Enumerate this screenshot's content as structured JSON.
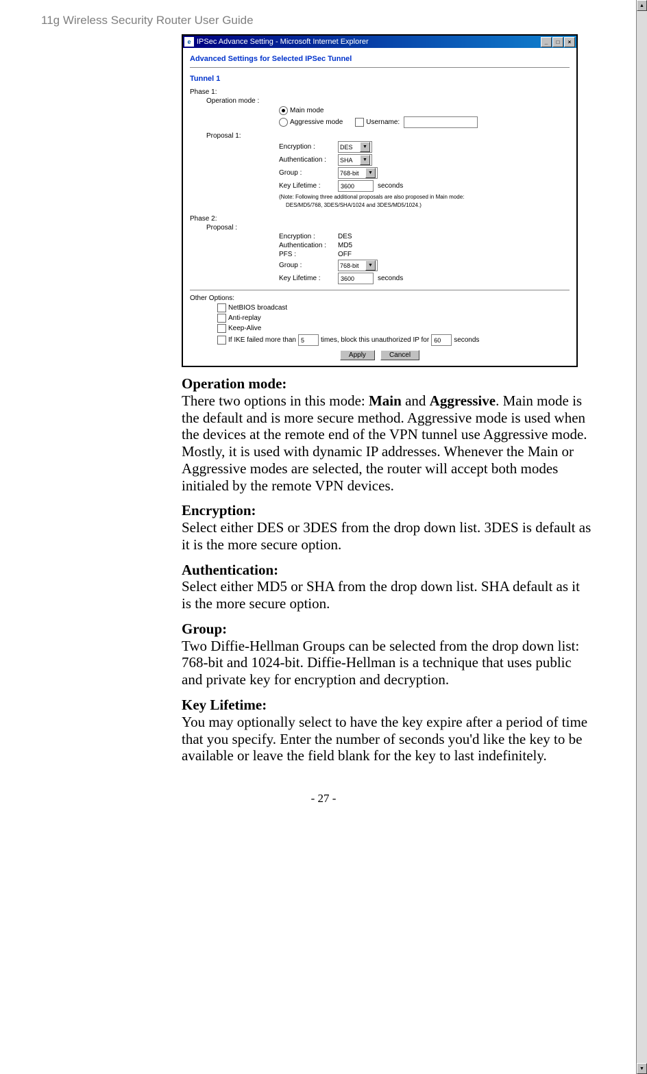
{
  "doc": {
    "header": "11g Wireless Security Router User Guide",
    "footer": "- 27 -"
  },
  "ie_window": {
    "title": "IPSec Advance Setting - Microsoft Internet Explorer",
    "min_symbol": "_",
    "max_symbol": "□",
    "close_symbol": "×"
  },
  "form": {
    "heading": "Advanced Settings for Selected IPSec Tunnel",
    "tunnel_label": "Tunnel 1",
    "phase1_label": "Phase 1:",
    "op_mode_label": "Operation mode :",
    "main_mode": "Main mode",
    "aggressive_mode": "Aggressive mode",
    "username_label": "Username:",
    "username_value": "",
    "proposal1_label": "Proposal 1:",
    "encryption_label": "Encryption :",
    "encryption_value": "DES",
    "auth_label": "Authentication :",
    "auth_value": "SHA",
    "group_label": "Group :",
    "group_value": "768-bit",
    "keylife_label": "Key Lifetime :",
    "keylife_value": "3600",
    "seconds": "seconds",
    "note1": "(Note: Following three additional proposals are also proposed in Main mode:",
    "note2": "DES/MD5/768, 3DES/SHA/1024 and 3DES/MD5/1024.)",
    "phase2_label": "Phase 2:",
    "proposal_label": "Proposal :",
    "p2_encryption_label": "Encryption :",
    "p2_encryption_value": "DES",
    "p2_auth_label": "Authentication :",
    "p2_auth_value": "MD5",
    "pfs_label": "PFS :",
    "pfs_value": "OFF",
    "p2_group_label": "Group :",
    "p2_group_value": "768-bit",
    "p2_keylife_label": "Key Lifetime :",
    "p2_keylife_value": "3600",
    "other_options_label": "Other Options:",
    "netbios": "NetBIOS broadcast",
    "antireplay": "Anti-replay",
    "keepalive": "Keep-Alive",
    "ike_fail_pre": "If IKE failed more than",
    "ike_fail_times": "5",
    "ike_fail_mid": "times, block this unauthorized IP for",
    "ike_fail_secs": "60",
    "apply": "Apply",
    "cancel": "Cancel"
  },
  "body": {
    "op_mode_h": "Operation mode:",
    "op_mode_p": "There two options in this mode: Main and Aggressive. Main mode is the default and is more secure method. Aggressive mode is used when the devices at the remote end of the VPN tunnel use Aggressive mode. Mostly, it is used with dynamic IP addresses. Whenever the Main or Aggressive modes are selected, the router will accept both modes initialed by the remote VPN devices.",
    "enc_h": "Encryption:",
    "enc_p": "Select either DES or 3DES from the drop down list. 3DES is default as it is the more secure option.",
    "auth_h": "Authentication:",
    "auth_p": "Select either MD5 or SHA from the drop down list. SHA default as it is the more secure option.",
    "group_h": "Group:",
    "group_p": "Two Diffie-Hellman Groups can be selected from the drop down list: 768-bit and 1024-bit. Diffie-Hellman is a technique that uses public and private key for encryption and decryption.",
    "keylife_h": "Key Lifetime:",
    "keylife_p": "You may optionally select to have the key expire after a period of time that you specify. Enter the number of seconds you'd like the key to be available or leave the field blank for the key to last indefinitely."
  }
}
